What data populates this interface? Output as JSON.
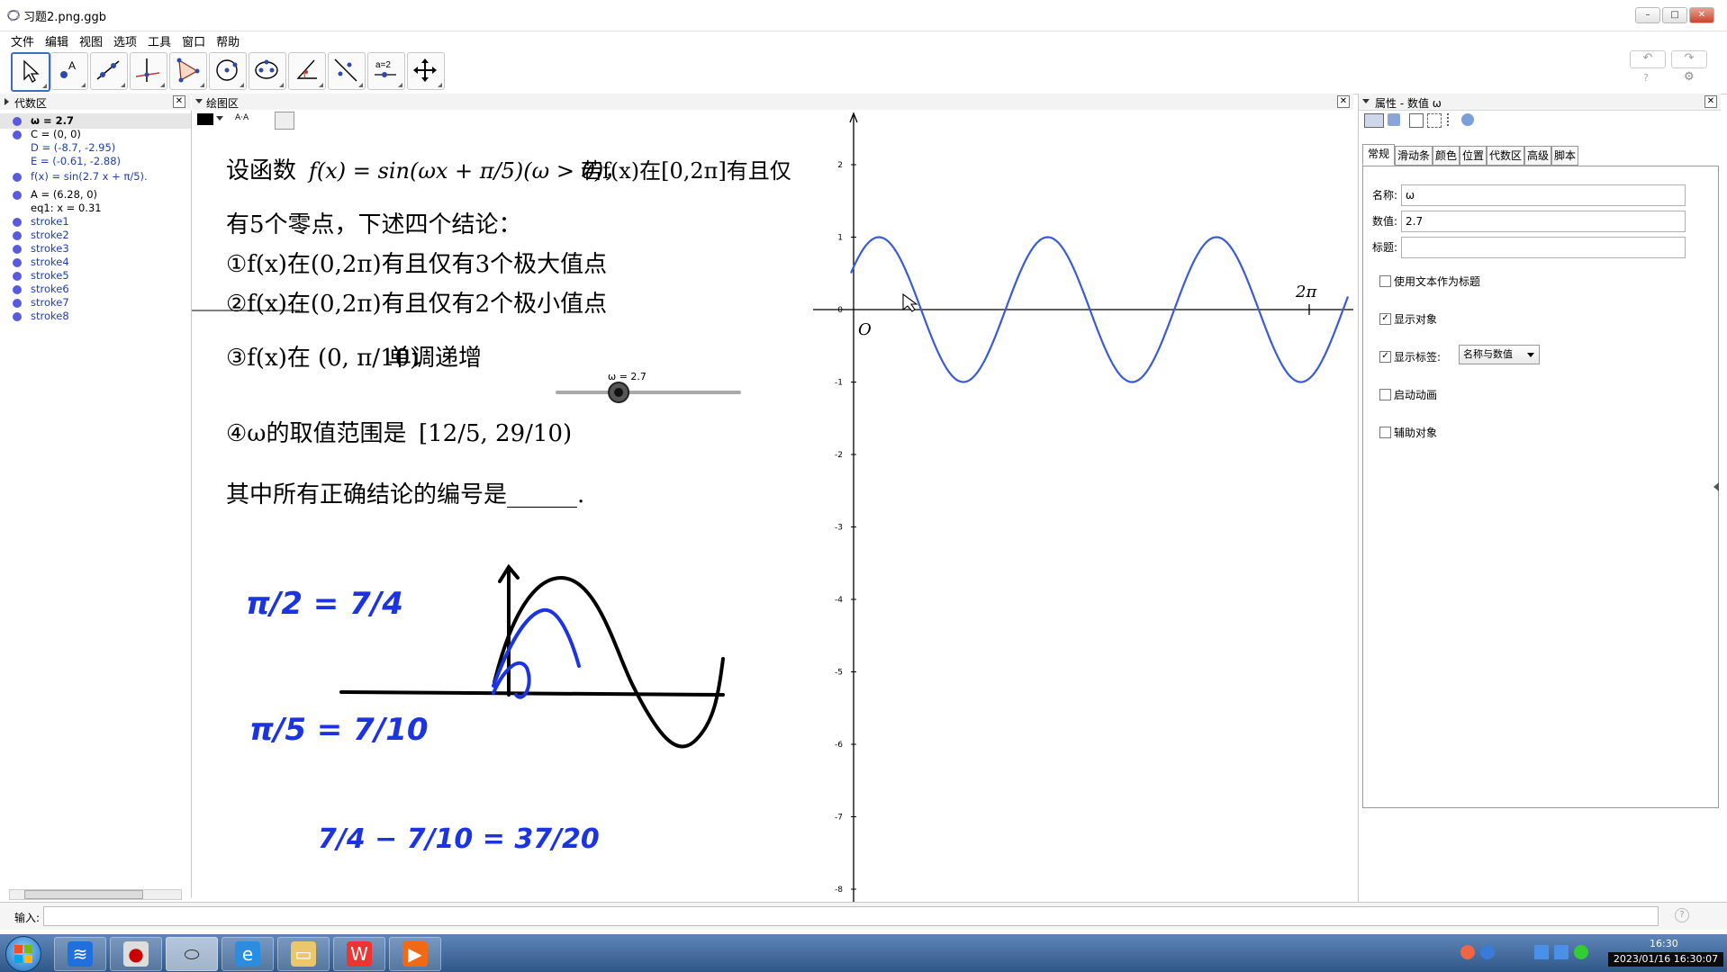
{
  "window": {
    "title": "习题2.png.ggb",
    "buttons": {
      "minimize": "–",
      "maximize": "□",
      "close": "✕"
    }
  },
  "menu": [
    "文件",
    "编辑",
    "视图",
    "选项",
    "工具",
    "窗口",
    "帮助"
  ],
  "toolbar": {
    "tools": [
      "move-tool",
      "point-tool",
      "line-tool",
      "perpendicular-tool",
      "polygon-tool",
      "circle-tool",
      "conic-tool",
      "angle-tool",
      "reflect-tool",
      "slider-tool",
      "move-view-tool"
    ],
    "slider_tool_label": "a=2",
    "undo": "↶",
    "redo": "↷",
    "help": "?",
    "settings": "⚙"
  },
  "algebra": {
    "title": "代数区",
    "rows": [
      {
        "text": "ω = 2.7",
        "dot": true,
        "style": "bold"
      },
      {
        "text": "C = (0, 0)",
        "dot": true,
        "style": ""
      },
      {
        "text": "D = (-8.7, -2.95)",
        "dot": false,
        "style": "blue"
      },
      {
        "text": "E = (-0.61, -2.88)",
        "dot": false,
        "style": "blue"
      },
      {
        "text": "f(x) = sin(2.7 x + π/5).",
        "dot": true,
        "style": "blue"
      },
      {
        "text": "A = (6.28, 0)",
        "dot": true,
        "style": ""
      },
      {
        "text": "eq1: x = 0.31",
        "dot": false,
        "style": ""
      },
      {
        "text": "stroke1",
        "dot": true,
        "style": "blue"
      },
      {
        "text": "stroke2",
        "dot": true,
        "style": "blue"
      },
      {
        "text": "stroke3",
        "dot": true,
        "style": "blue"
      },
      {
        "text": "stroke4",
        "dot": true,
        "style": "blue"
      },
      {
        "text": "stroke5",
        "dot": true,
        "style": "blue"
      },
      {
        "text": "stroke6",
        "dot": true,
        "style": "blue"
      },
      {
        "text": "stroke7",
        "dot": true,
        "style": "blue"
      },
      {
        "text": "stroke8",
        "dot": true,
        "style": "blue"
      }
    ]
  },
  "graphics": {
    "title": "绘图区",
    "style_bar": {
      "color": "#000000",
      "text_size": "A·A"
    },
    "problem": {
      "line1_prefix": "设函数",
      "line1_func": "f(x) = sin(ωx + π/5)(ω > 0)，",
      "line1_suffix": "若f(x)在[0,2π]有且仅",
      "line2": "有5个零点，下述四个结论：",
      "c1": "①f(x)在(0,2π)有且仅有3个极大值点",
      "c2": "②f(x)在(0,2π)有且仅有2个极小值点",
      "c3_a": "③f(x)在",
      "c3_interval": "(0, π/10)",
      "c3_b": "单调递增",
      "c4_a": "④ω的取值范围是",
      "c4_interval": "[12/5, 29/10)",
      "question": "其中所有正确结论的编号是______."
    },
    "handwriting": {
      "eq1": "π/2 = 7/4",
      "eq2": "π/5 = 7/10",
      "eq3": "7/4 − 7/10 = 37/20"
    },
    "slider": {
      "label": "ω = 2.7",
      "value": 2.7,
      "min": 0,
      "max": 5
    },
    "axes": {
      "x_label_2pi": "2π",
      "origin_label": "O",
      "y_ticks": [
        "2",
        "1",
        "0",
        "-1",
        "-2",
        "-3",
        "-4",
        "-5",
        "-6",
        "-7",
        "-8"
      ]
    }
  },
  "chart_data": {
    "type": "line",
    "function": "f(x) = sin(2.7x + π/5)",
    "omega": 2.7,
    "phase": 0.628,
    "xlim": [
      0,
      6.28
    ],
    "ylim": [
      -8,
      2
    ],
    "series": [
      {
        "x_range": [
          0,
          6.28
        ]
      }
    ]
  },
  "properties": {
    "title": "属性 - 数值 ω",
    "tabs": [
      "常规",
      "滑动条",
      "颜色",
      "位置",
      "代数区",
      "高级",
      "脚本"
    ],
    "fields": {
      "name_label": "名称:",
      "name_value": "ω",
      "value_label": "数值:",
      "value_value": "2.7",
      "caption_label": "标题:",
      "caption_value": ""
    },
    "checkboxes": [
      {
        "label": "使用文本作为标题",
        "checked": false
      },
      {
        "label": "显示对象",
        "checked": true
      },
      {
        "label": "显示标签:",
        "checked": true
      },
      {
        "label": "启动动画",
        "checked": false
      },
      {
        "label": "辅助对象",
        "checked": false
      }
    ],
    "label_select": "名称与数值"
  },
  "input_bar": {
    "label": "输入:",
    "value": "",
    "help": "?"
  },
  "taskbar": {
    "time": "16:30",
    "datetime": "2023/01/16 16:30:07",
    "apps": [
      "start",
      "feishu",
      "screen-recorder",
      "geogebra",
      "ie",
      "explorer",
      "wps",
      "wps-presentation"
    ]
  }
}
